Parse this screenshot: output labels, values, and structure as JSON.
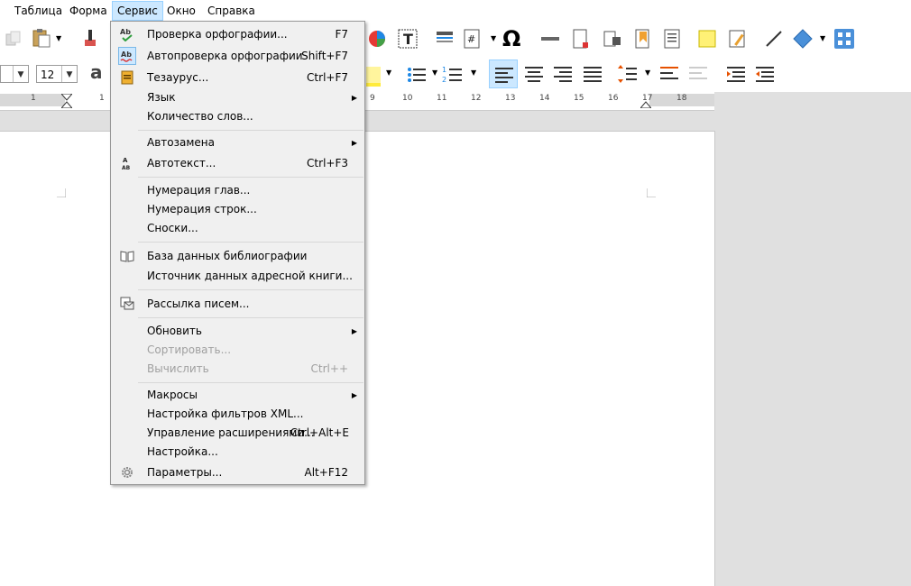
{
  "menubar": {
    "items": [
      {
        "label": "Таблица"
      },
      {
        "label": "Форма"
      },
      {
        "label": "Сервис"
      },
      {
        "label": "Окно"
      },
      {
        "label": "Справка"
      }
    ]
  },
  "toolbar": {
    "font_size": "12",
    "icons": [
      "clone-formatting-icon",
      "paste-icon",
      "paintbrush-icon",
      "chart-icon",
      "text-box-icon",
      "field-icon",
      "omega-icon",
      "hyperlink-icon",
      "footnote-icon",
      "comment-icon",
      "line-icon",
      "shapes-icon"
    ]
  },
  "ruler": {
    "numbers": [
      "1",
      "1",
      "9",
      "10",
      "11",
      "12",
      "13",
      "14",
      "15",
      "16",
      "17",
      "18"
    ]
  },
  "service_menu": {
    "items": [
      {
        "label": "Проверка орфографии...",
        "shortcut": "F7",
        "icon": "spellcheck-icon"
      },
      {
        "label": "Автопроверка орфографии",
        "shortcut": "Shift+F7",
        "icon": "auto-spellcheck-icon"
      },
      {
        "label": "Тезаурус...",
        "shortcut": "Ctrl+F7",
        "icon": "thesaurus-icon"
      },
      {
        "label": "Язык",
        "shortcut": "",
        "submenu": true
      },
      {
        "label": "Количество слов...",
        "shortcut": ""
      },
      {
        "label": "Автозамена",
        "shortcut": "",
        "submenu": true
      },
      {
        "label": "Автотекст...",
        "shortcut": "Ctrl+F3",
        "icon": "autotext-icon"
      },
      {
        "label": "Нумерация глав...",
        "shortcut": ""
      },
      {
        "label": "Нумерация строк...",
        "shortcut": ""
      },
      {
        "label": "Сноски...",
        "shortcut": ""
      },
      {
        "label": "База данных библиографии",
        "shortcut": "",
        "icon": "book-icon"
      },
      {
        "label": "Источник данных адресной книги...",
        "shortcut": ""
      },
      {
        "label": "Рассылка писем...",
        "shortcut": "",
        "icon": "mail-merge-icon"
      },
      {
        "label": "Обновить",
        "shortcut": "",
        "submenu": true
      },
      {
        "label": "Сортировать...",
        "shortcut": "",
        "disabled": true
      },
      {
        "label": "Вычислить",
        "shortcut": "Ctrl++",
        "disabled": true
      },
      {
        "label": "Макросы",
        "shortcut": "",
        "submenu": true
      },
      {
        "label": "Настройка фильтров XML...",
        "shortcut": ""
      },
      {
        "label": "Управление расширениями...",
        "shortcut": "Ctrl+Alt+E"
      },
      {
        "label": "Настройка...",
        "shortcut": ""
      },
      {
        "label": "Параметры...",
        "shortcut": "Alt+F12",
        "icon": "gear-icon"
      }
    ]
  }
}
